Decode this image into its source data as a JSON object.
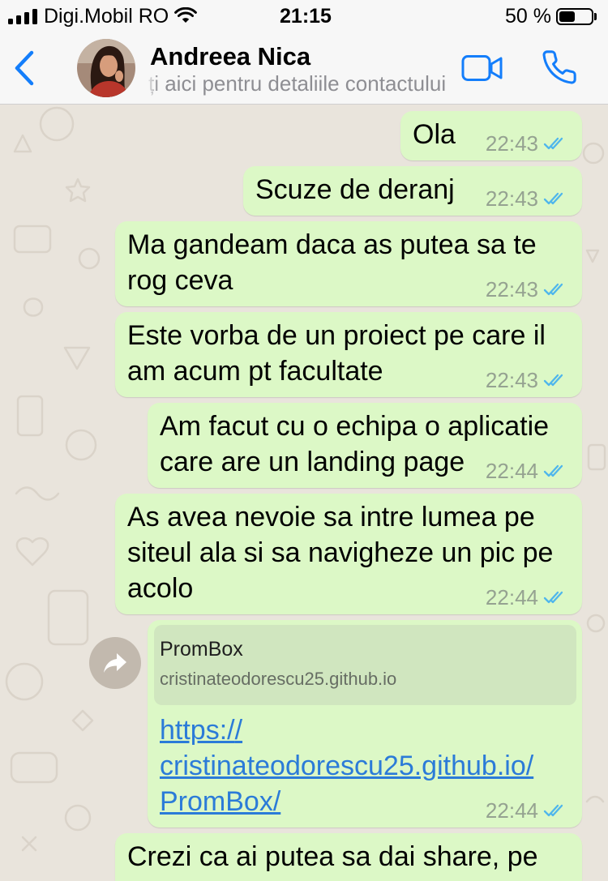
{
  "status_bar": {
    "carrier": "Digi.Mobil RO",
    "time": "21:15",
    "battery_label": "50 %",
    "battery_level": 0.5,
    "icons": {
      "signal": "cellular-signal-icon",
      "wifi": "wifi-icon",
      "battery": "battery-icon"
    }
  },
  "header": {
    "contact_name": "Andreea Nica",
    "subtitle": "ți aici pentru detaliile contactului",
    "icons": {
      "back": "chevron-left-icon",
      "avatar": "contact-avatar",
      "video_call": "video-camera-icon",
      "voice_call": "phone-icon"
    }
  },
  "theme": {
    "accent": "#147efb",
    "outgoing_bubble": "#dcf8c6",
    "link_preview_bg": "#d0e6bf",
    "link": "#2b7bd8",
    "read_ticks": "#4fb6ec",
    "timestamp": "#95a291",
    "wallpaper": "#e9e4dc"
  },
  "messages": [
    {
      "text": "Ola",
      "time": "22:43",
      "tick_icon": "double-check-read-icon"
    },
    {
      "text": "Scuze de deranj",
      "time": "22:43",
      "tick_icon": "double-check-read-icon"
    },
    {
      "text": "Ma gandeam daca as putea sa te rog ceva",
      "time": "22:43",
      "tick_icon": "double-check-read-icon"
    },
    {
      "text": "Este vorba de un proiect pe care il am acum pt facultate",
      "time": "22:43",
      "tick_icon": "double-check-read-icon"
    },
    {
      "text": "Am facut cu o echipa o aplicatie care are un landing page",
      "time": "22:44",
      "tick_icon": "double-check-read-icon"
    },
    {
      "text": "As avea nevoie sa intre lumea pe siteul ala si sa navigheze un pic pe acolo",
      "time": "22:44",
      "tick_icon": "double-check-read-icon"
    },
    {
      "link_preview": {
        "title": "PromBox",
        "domain": "cristinateodorescu25.github.io"
      },
      "url": "https://cristinateodorescu25.github.io/PromBox/",
      "time": "22:44",
      "tick_icon": "double-check-read-icon",
      "forward_icon": "forward-arrow-icon"
    },
    {
      "text": "Crezi ca ai putea sa dai share, pe"
    }
  ]
}
